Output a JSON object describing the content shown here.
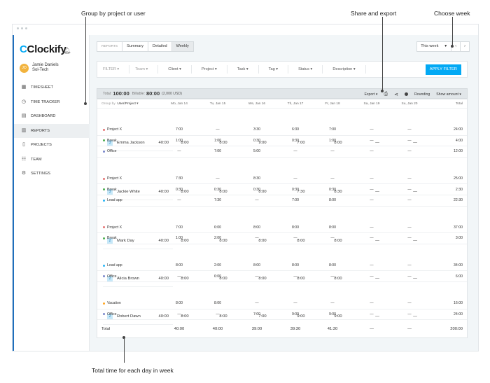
{
  "annotations": {
    "group": "Group by project or user",
    "share": "Share and export",
    "choose": "Choose week",
    "total": "Total time for each day in week"
  },
  "sidebar": {
    "brand": "Clockify",
    "brand_mark": "C",
    "user_name": "Jamie Daniels",
    "user_company": "Sol-Tech",
    "user_initials": "JD",
    "items": [
      {
        "label": "TIMESHEET",
        "icon": "timesheet-icon",
        "color": "#4f9fd8"
      },
      {
        "label": "TIME TRACKER",
        "icon": "clock-icon",
        "color": "#f6c146"
      },
      {
        "label": "DASHBOARD",
        "icon": "dashboard-icon",
        "color": "#2c3e50"
      },
      {
        "label": "REPORTS",
        "icon": "reports-icon",
        "color": "#e23c6f"
      },
      {
        "label": "PROJECTS",
        "icon": "projects-icon",
        "color": "#e23c6f"
      },
      {
        "label": "TEAM",
        "icon": "team-icon",
        "color": "#9c27b0"
      },
      {
        "label": "SETTINGS",
        "icon": "gear-icon",
        "color": "#4caf50"
      }
    ]
  },
  "tabs": {
    "label": "REPORTS",
    "summary": "Summary",
    "detailed": "Detailed",
    "weekly": "Weekly"
  },
  "week": {
    "select": "This week",
    "prev": "‹",
    "next": "›"
  },
  "filters": {
    "label": "FILTER",
    "items": [
      "Team",
      "Client",
      "Project",
      "Task",
      "Tag",
      "Status",
      "Description"
    ],
    "apply": "APPLY FILTER"
  },
  "totals": {
    "total_label": "Total:",
    "total_value": "100:00",
    "billable_label": "Billable:",
    "billable_value": "80:00",
    "billable_amount": "(2,000 USD)",
    "export": "Export",
    "rounding": "Rounding",
    "show_amount": "Show amount"
  },
  "table": {
    "group_label": "Group by",
    "group_value": "User/Project",
    "days": [
      "Mo, Jan 14",
      "Tu, Jan 15",
      "We, Jan 16",
      "Th, Jan 17",
      "Fr, Jan 18",
      "Sa, Jan 19",
      "Su, Jan 20"
    ],
    "total_header": "Total",
    "users": [
      {
        "count": "3",
        "name": "Emma Jackson",
        "values": [
          "8:00",
          "8:00",
          "9:00",
          "7:00",
          "8:00",
          "—",
          "—"
        ],
        "total": "40:00",
        "projects": [
          {
            "name": "Project X",
            "color": "#e57373",
            "values": [
              "7:00",
              "—",
              "3:30",
              "6:30",
              "7:00",
              "—",
              "—"
            ],
            "total": "24:00"
          },
          {
            "name": "Break",
            "color": "#4caf50",
            "values": [
              "1:00",
              "1:00",
              "0:30",
              "0:30",
              "1:00",
              "—",
              "—"
            ],
            "total": "4:00"
          },
          {
            "name": "Office",
            "color": "#7986cb",
            "values": [
              "—",
              "7:00",
              "5:00",
              "—",
              "—",
              "—",
              "—"
            ],
            "total": "12:00"
          }
        ]
      },
      {
        "count": "3",
        "name": "Jackie White",
        "values": [
          "8:00",
          "8:00",
          "8:00",
          "7:30",
          "8:30",
          "—",
          "—"
        ],
        "total": "40:00",
        "projects": [
          {
            "name": "Project X",
            "color": "#e57373",
            "values": [
              "7:30",
              "—",
              "8:30",
              "—",
              "—",
              "—",
              "—"
            ],
            "total": "25:00"
          },
          {
            "name": "Break",
            "color": "#4caf50",
            "values": [
              "0:30",
              "0:30",
              "0:30",
              "0:30",
              "0:30",
              "—",
              "—"
            ],
            "total": "2:30"
          },
          {
            "name": "Lead app",
            "color": "#29b6f6",
            "values": [
              "—",
              "7:30",
              "—",
              "7:00",
              "8:00",
              "—",
              "—"
            ],
            "total": "22:30"
          }
        ]
      },
      {
        "count": "2",
        "name": "Mark Day",
        "values": [
          "8:00",
          "8:00",
          "8:00",
          "8:00",
          "8:00",
          "—",
          "—"
        ],
        "total": "40:00",
        "projects": [
          {
            "name": "Project X",
            "color": "#e57373",
            "values": [
              "7:00",
              "6:00",
              "8:00",
              "8:00",
              "8:00",
              "—",
              "—"
            ],
            "total": "37:00"
          },
          {
            "name": "Break",
            "color": "#4caf50",
            "values": [
              "1:00",
              "2:00",
              "—",
              "—",
              "—",
              "—",
              "—"
            ],
            "total": "3:00"
          }
        ]
      },
      {
        "count": "2",
        "name": "Alicia Brown",
        "values": [
          "8:00",
          "8:00",
          "8:00",
          "8:00",
          "8:00",
          "—",
          "—"
        ],
        "total": "40:00",
        "projects": [
          {
            "name": "Lead app",
            "color": "#29b6f6",
            "values": [
              "8:00",
              "2:00",
              "8:00",
              "8:00",
              "8:00",
              "—",
              "—"
            ],
            "total": "34:00"
          },
          {
            "name": "Office",
            "color": "#7986cb",
            "values": [
              "—",
              "6:00",
              "—",
              "—",
              "—",
              "—",
              "—"
            ],
            "total": "6:00"
          }
        ]
      },
      {
        "count": "2",
        "name": "Robert Dawn",
        "values": [
          "8:00",
          "8:00",
          "7:00",
          "9:00",
          "9:00",
          "—",
          "—"
        ],
        "total": "40:00",
        "projects": [
          {
            "name": "Vacation",
            "color": "#ffa726",
            "values": [
              "8:00",
              "8:00",
              "—",
              "—",
              "—",
              "—",
              "—"
            ],
            "total": "16:00"
          },
          {
            "name": "Office",
            "color": "#7986cb",
            "values": [
              "—",
              "—",
              "7:00",
              "9:00",
              "9:00",
              "—",
              "—"
            ],
            "total": "24:00"
          }
        ]
      }
    ],
    "total_row": {
      "label": "Total",
      "values": [
        "40:00",
        "40:00",
        "39:00",
        "39:30",
        "41:30",
        "—",
        "—"
      ],
      "total": "200:00"
    }
  }
}
